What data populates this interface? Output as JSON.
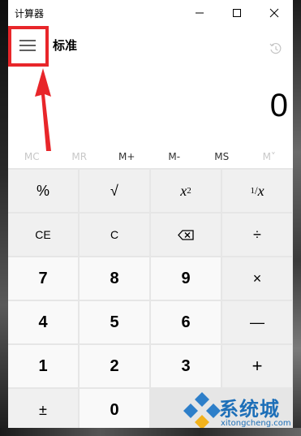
{
  "window": {
    "title": "计算器"
  },
  "header": {
    "mode": "标准"
  },
  "display": {
    "value": "0"
  },
  "memory": [
    {
      "label": "MC",
      "enabled": false
    },
    {
      "label": "MR",
      "enabled": false
    },
    {
      "label": "M+",
      "enabled": true
    },
    {
      "label": "M-",
      "enabled": true
    },
    {
      "label": "MS",
      "enabled": true
    },
    {
      "label": "M˅",
      "enabled": false
    }
  ],
  "keys": {
    "percent": "%",
    "sqrt": "√",
    "square_base": "x",
    "square_exp": "2",
    "reciprocal_num": "1",
    "reciprocal_den": "x",
    "ce": "CE",
    "c": "C",
    "divide": "÷",
    "seven": "7",
    "eight": "8",
    "nine": "9",
    "multiply": "×",
    "four": "4",
    "five": "5",
    "six": "6",
    "minus": "—",
    "one": "1",
    "two": "2",
    "three": "3",
    "plus": "+",
    "negate": "±",
    "zero": "0"
  },
  "watermark": {
    "main": "系统城",
    "sub": "xitongcheng.com"
  },
  "colors": {
    "annotation": "#e8262a",
    "watermark": "#1d6fb8"
  },
  "icons": {
    "menu": "hamburger-icon",
    "history": "history-icon",
    "minimize": "minimize-icon",
    "maximize": "maximize-icon",
    "close": "close-icon",
    "backspace": "backspace-icon"
  }
}
